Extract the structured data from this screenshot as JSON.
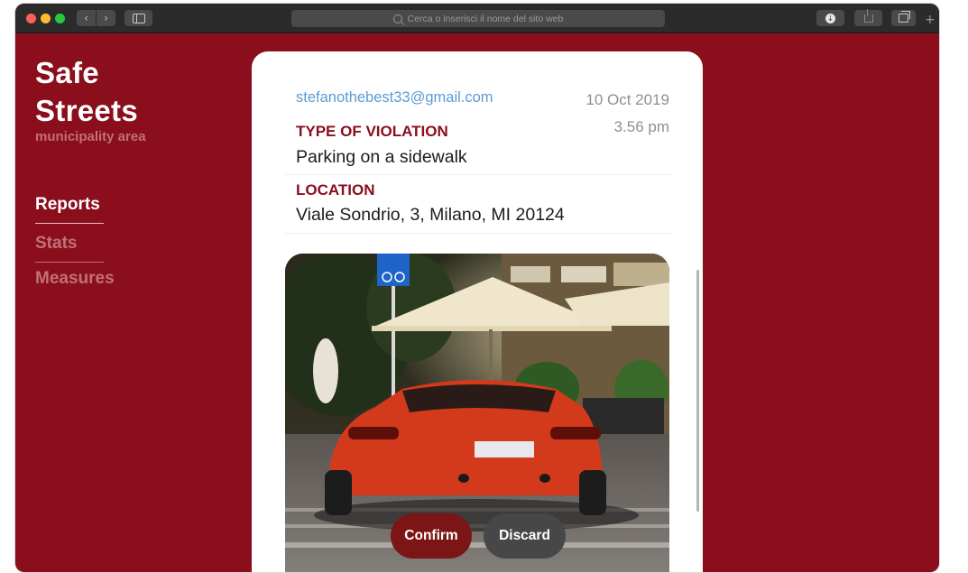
{
  "browser": {
    "url_placeholder": "Cerca o inserisci il nome del sito web",
    "icons": [
      "back-icon",
      "forward-icon",
      "sidebar-icon",
      "search-icon",
      "download-icon",
      "share-icon",
      "tabs-icon",
      "new-tab-icon"
    ]
  },
  "brand": {
    "title": "Safe\nStreets",
    "subtitle": "municipality area"
  },
  "nav": {
    "items": [
      {
        "label": "Reports",
        "active": true
      },
      {
        "label": "Stats",
        "active": false
      },
      {
        "label": "Measures",
        "active": false
      }
    ]
  },
  "report": {
    "email": "stefanothebest33@gmail.com",
    "date": "10 Oct 2019",
    "time": "3.56 pm",
    "violation_label": "TYPE OF VIOLATION",
    "violation_value": "Parking on a sidewalk",
    "location_label": "LOCATION",
    "location_value": "Viale Sondrio, 3, Milano, MI 20124",
    "photo_subject": "red sports car parked on sidewalk under cafe umbrella"
  },
  "actions": {
    "confirm_label": "Confirm",
    "discard_label": "Discard"
  },
  "colors": {
    "brand_red": "#8a0e1c",
    "nav_inactive": "#c2707a",
    "email_blue": "#5b9bd5",
    "confirm_bg": "#7c1515",
    "discard_bg": "#474747"
  }
}
